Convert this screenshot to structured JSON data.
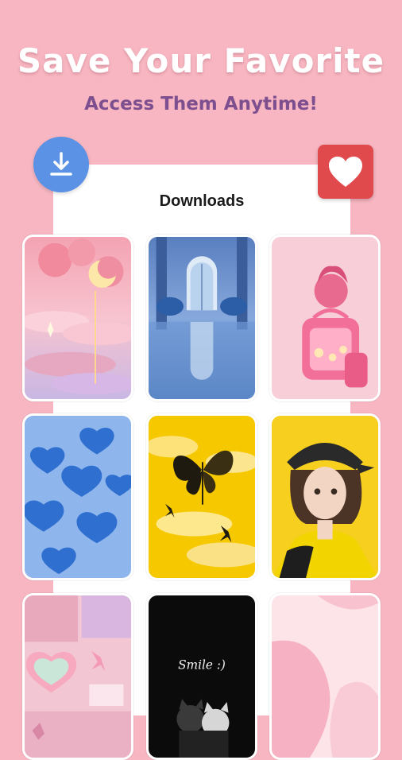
{
  "promo": {
    "headline": "Save Your Favorite",
    "subheadline": "Access Them Anytime!"
  },
  "panel": {
    "title": "Downloads"
  },
  "icons": {
    "download": "download-icon",
    "favorite": "heart-icon"
  },
  "wallpapers": [
    {
      "name": "pink-clouds-tulips",
      "caption": ""
    },
    {
      "name": "blue-palace-hall",
      "caption": ""
    },
    {
      "name": "pink-backpack-girl",
      "caption": ""
    },
    {
      "name": "blue-hearts",
      "caption": ""
    },
    {
      "name": "yellow-butterflies",
      "caption": ""
    },
    {
      "name": "anime-girl-yellow-jacket",
      "caption": ""
    },
    {
      "name": "pink-heart-collage",
      "caption": ""
    },
    {
      "name": "smile-cats",
      "caption": "Smile :)"
    },
    {
      "name": "pink-abstract-waves",
      "caption": ""
    }
  ],
  "colors": {
    "background": "#f7b6c1",
    "headline": "#ffffff",
    "subheadline": "#7e4f8f",
    "download_button": "#5b92e5",
    "favorite_button": "#e04a4d"
  }
}
